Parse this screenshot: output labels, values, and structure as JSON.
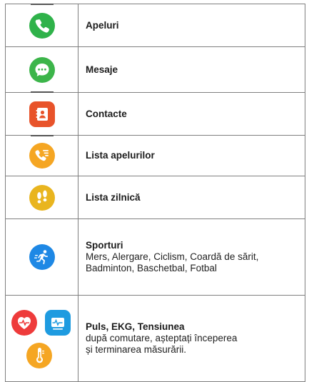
{
  "rows": [
    {
      "label": "Apeluri",
      "icon": "phone-icon",
      "color": "#2fb24a"
    },
    {
      "label": "Mesaje",
      "icon": "message-icon",
      "color": "#3cb54a"
    },
    {
      "label": "Contacte",
      "icon": "contacts-icon",
      "color": "#e8532a"
    },
    {
      "label": "Lista apelurilor",
      "icon": "call-list-icon",
      "color": "#f5a623"
    },
    {
      "label": "Lista zilnică",
      "icon": "footsteps-icon",
      "color": "#e9b51f"
    },
    {
      "label": "Sporturi",
      "desc1": "Mers, Alergare, Ciclism, Coardă de sărit,",
      "desc2": "Badminton, Baschetbal, Fotbal",
      "icon": "running-icon",
      "color": "#1e88e5"
    },
    {
      "label": "Puls, EKG, Tensiunea",
      "desc1": "după comutare, așteptați începerea",
      "desc2": "și terminarea măsurării.",
      "icons": [
        "heart-rate-icon",
        "ecg-icon",
        "thermometer-icon"
      ],
      "colors": [
        "#ee3b3b",
        "#1e9be0",
        "#f5a623"
      ]
    }
  ]
}
